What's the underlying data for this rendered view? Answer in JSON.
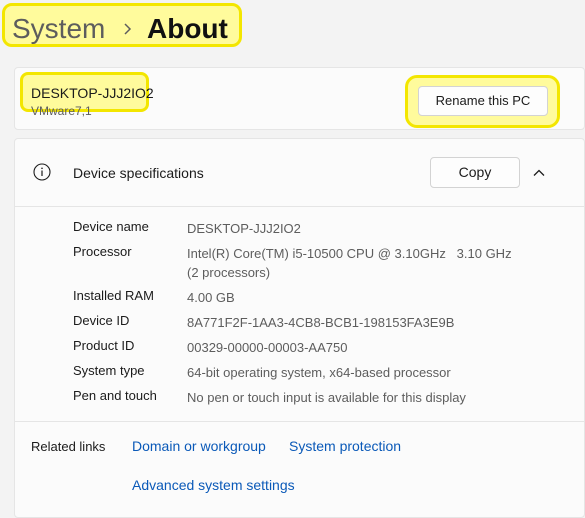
{
  "breadcrumb": {
    "parent": "System",
    "current": "About"
  },
  "device": {
    "name": "DESKTOP-JJJ2IO2",
    "model": "VMware7,1",
    "rename_label": "Rename this PC"
  },
  "specs": {
    "title": "Device specifications",
    "copy_label": "Copy",
    "rows": [
      {
        "label": "Device name",
        "value": "DESKTOP-JJJ2IO2"
      },
      {
        "label": "Processor",
        "value": "Intel(R) Core(TM) i5-10500 CPU @ 3.10GHz   3.10 GHz",
        "value2": "(2 processors)"
      },
      {
        "label": "Installed RAM",
        "value": "4.00 GB"
      },
      {
        "label": "Device ID",
        "value": "8A771F2F-1AA3-4CB8-BCB1-198153FA3E9B"
      },
      {
        "label": "Product ID",
        "value": "00329-00000-00003-AA750"
      },
      {
        "label": "System type",
        "value": "64-bit operating system, x64-based processor"
      },
      {
        "label": "Pen and touch",
        "value": "No pen or touch input is available for this display"
      }
    ]
  },
  "related": {
    "title": "Related links",
    "links": [
      "Domain or workgroup",
      "System protection",
      "Advanced system settings"
    ]
  },
  "colors": {
    "highlight": "#fffb9c",
    "highlight_border": "#f3e600",
    "link": "#0a59b8"
  }
}
